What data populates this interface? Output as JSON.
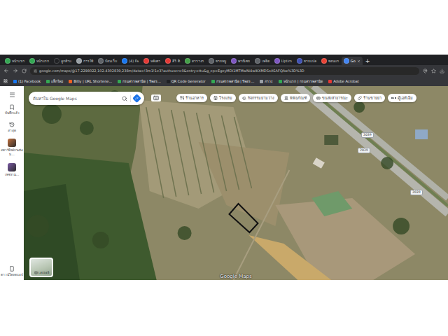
{
  "tabs": [
    {
      "label": "หน้าแรก",
      "selected": false,
      "color": "#34a853"
    },
    {
      "label": "หน้าแรก",
      "selected": false,
      "color": "#34a853"
    },
    {
      "label": "ลูกค้าแ",
      "selected": false,
      "color": "#202124"
    },
    {
      "label": "การใช้",
      "selected": false,
      "color": "#9aa0a6"
    },
    {
      "label": "ป้อนเว็บ",
      "selected": false,
      "color": "#5f6368"
    },
    {
      "label": "(4) Fa",
      "selected": false,
      "color": "#1877f2"
    },
    {
      "label": "หลังคา",
      "selected": false,
      "color": "#e53935"
    },
    {
      "label": "สีวิ ดิ",
      "selected": false,
      "color": "#e53935"
    },
    {
      "label": "ตารางก",
      "selected": false,
      "color": "#43a047"
    },
    {
      "label": "ขายหมู",
      "selected": false,
      "color": "#5f6368"
    },
    {
      "label": "พาณิชย",
      "selected": false,
      "color": "#7e57c2"
    },
    {
      "label": "เพจิต",
      "selected": false,
      "color": "#5f6368"
    },
    {
      "label": "Uptim",
      "selected": false,
      "color": "#7e57c2"
    },
    {
      "label": "ขายแปล",
      "selected": false,
      "color": "#3f51b5"
    },
    {
      "label": "ขอนแก",
      "selected": false,
      "color": "#ea4335"
    },
    {
      "label": "Go",
      "selected": true,
      "color": "#4285f4"
    }
  ],
  "new_tab": "+",
  "address": "google.com/maps/@17.2298022,102.4302839,238m/data=!3m1!1e3?authuser=0&entry=ttu&g_ep=EgoyMDI1MTMwNi4wIKXMDSoASAFQAw%3D%3D",
  "bookmarks": [
    {
      "label": "(1) Facebook",
      "color": "#1877f2"
    },
    {
      "label": "แท็กใหม่",
      "color": "#34a853"
    },
    {
      "label": "Bitly | URL Shortene...",
      "color": "#ee6123"
    },
    {
      "label": "กรมสรรพสามิต | รีพอร...",
      "color": "#34a853"
    },
    {
      "label": "QR Code Generator",
      "color": "#202124"
    },
    {
      "label": "กรมสรรพสามิต | รีพอร...",
      "color": "#34a853"
    },
    {
      "label": "ภาวะ",
      "color": "#9aa0a6"
    },
    {
      "label": "หน้าแรก | กรมสรรพสามิต",
      "color": "#34a853"
    },
    {
      "label": "Adobe Acrobat",
      "color": "#e53935"
    }
  ],
  "sidebar": {
    "items": [
      {
        "label": "บันทึกแล้ว",
        "kind": "icon",
        "color": "#3c4043"
      },
      {
        "label": "ล่าสุด",
        "kind": "icon",
        "color": "#3c4043"
      },
      {
        "label": "สตาร์ทิงค์กระท่อม...",
        "kind": "thumb",
        "color": "#c2703d"
      },
      {
        "label": "เพชราม...",
        "kind": "thumb",
        "color": "#7b5aa6"
      }
    ],
    "download": "ดาวน์โหลดแอป"
  },
  "search": {
    "placeholder": "ค้นหาใน Google Maps"
  },
  "chips": [
    {
      "label": "ร้านอาหาร",
      "kind": "icon"
    },
    {
      "label": "โรงแรม",
      "kind": "icon"
    },
    {
      "label": "กิจกรรมยามว่าง",
      "kind": "icon"
    },
    {
      "label": "พิพิธภัณฑ์",
      "kind": "icon"
    },
    {
      "label": "ขนส่งสาธารณะ",
      "kind": "icon"
    },
    {
      "label": "ร้านขายยา",
      "kind": "icon"
    },
    {
      "label": "ตู้เอทีเอ็ม",
      "kind": "more"
    }
  ],
  "road_labels": [
    "2039",
    "2039",
    "2039"
  ],
  "layers": "เลเยอร์",
  "watermark": "Google Maps"
}
